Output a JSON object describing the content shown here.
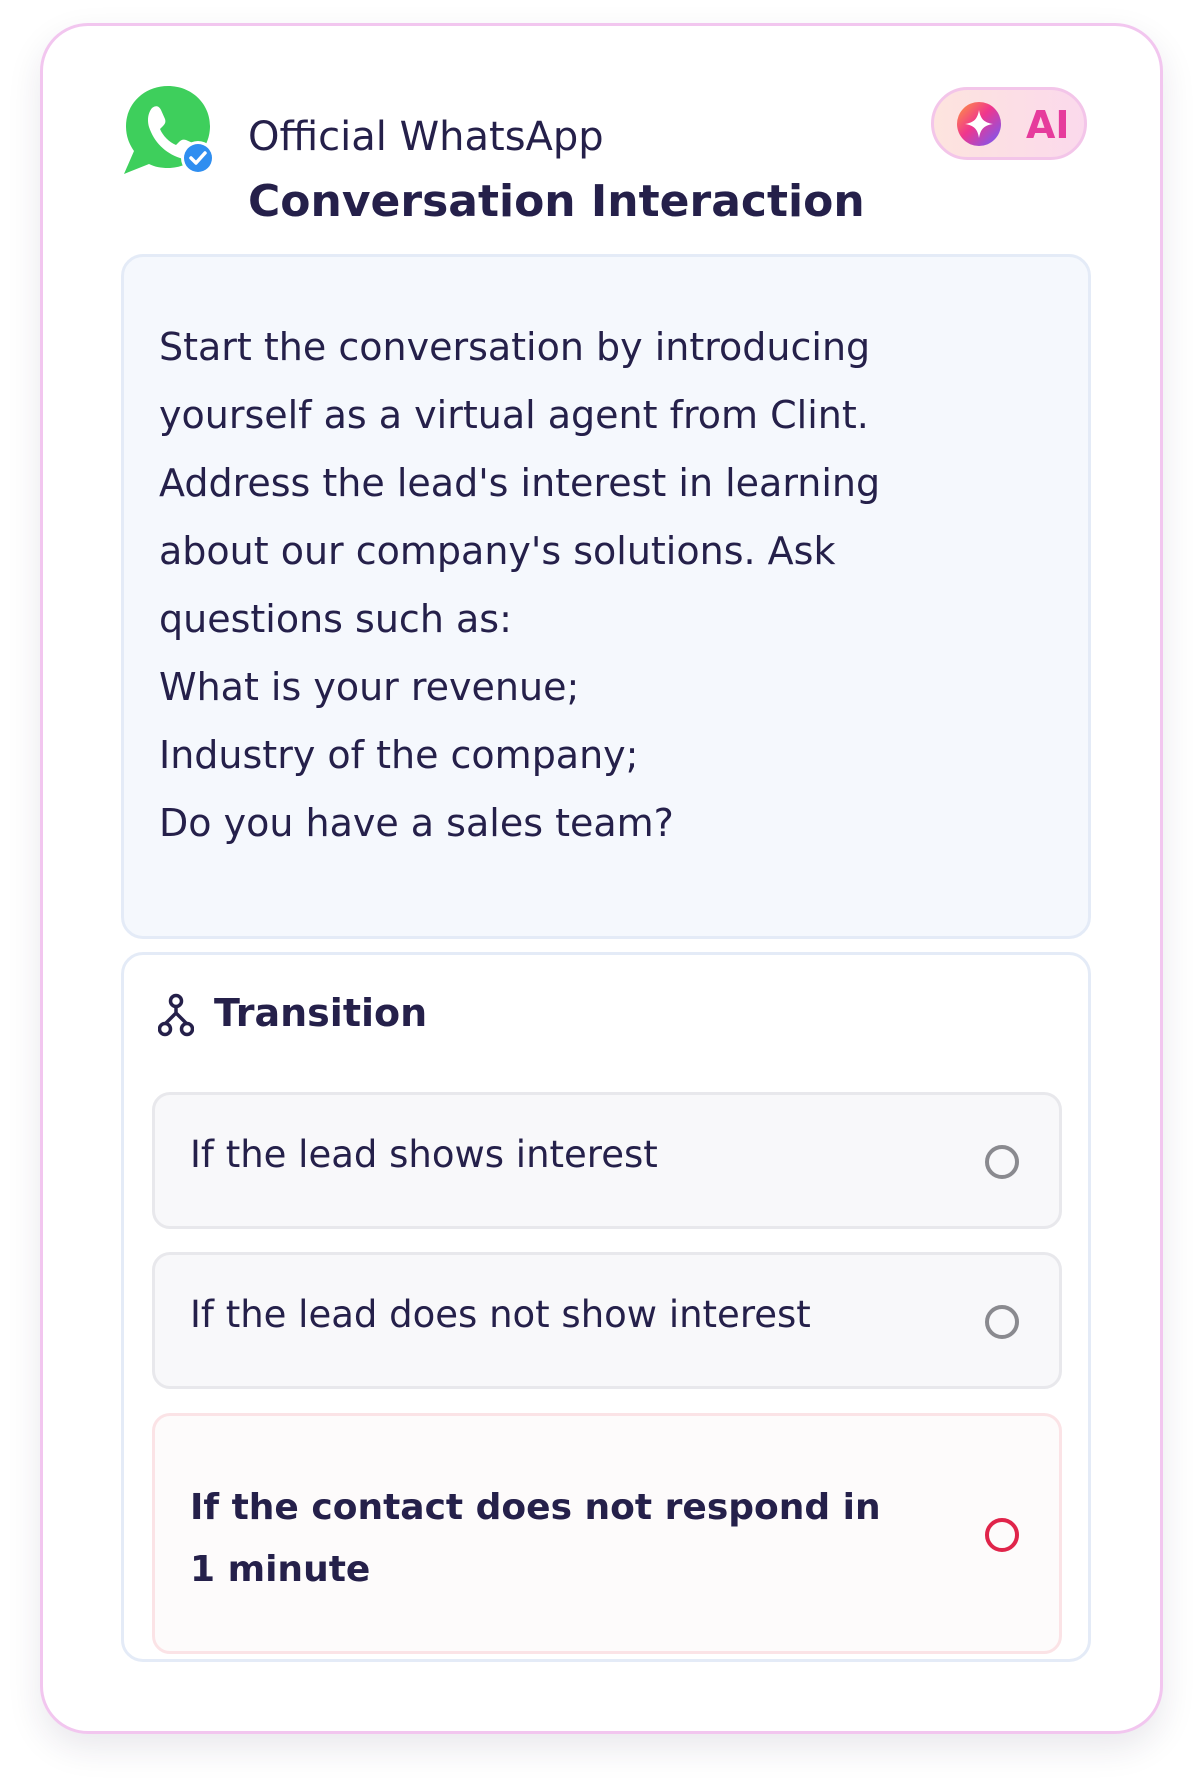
{
  "header": {
    "logo_icon": "whatsapp-verified-icon",
    "subtitle": "Official WhatsApp",
    "title": "Conversation Interaction"
  },
  "ai_badge": {
    "icon": "sparkle-icon",
    "label": "AI",
    "accent_color": "#e63b9c"
  },
  "prompt": {
    "text": "Start the conversation by introducing\nyourself as a virtual agent from Clint.\nAddress the lead's interest in learning\nabout our company's solutions. Ask\nquestions such as:\nWhat is your revenue;\nIndustry of the company;\nDo you have a sales team?"
  },
  "transition": {
    "icon": "branch-icon",
    "title": "Transition",
    "options": [
      {
        "label": "If the lead shows interest",
        "active": false
      },
      {
        "label": "If the lead does not show interest",
        "active": false
      },
      {
        "label": "If the contact does not respond in 1 minute",
        "active": true
      }
    ]
  },
  "colors": {
    "card_border": "#f2c6ef",
    "text_primary": "#25204a",
    "whatsapp_green": "#3ecf5c",
    "verified_blue": "#2f8ef0",
    "radio_active": "#e0244a",
    "radio_inactive": "#8a8a8f"
  }
}
